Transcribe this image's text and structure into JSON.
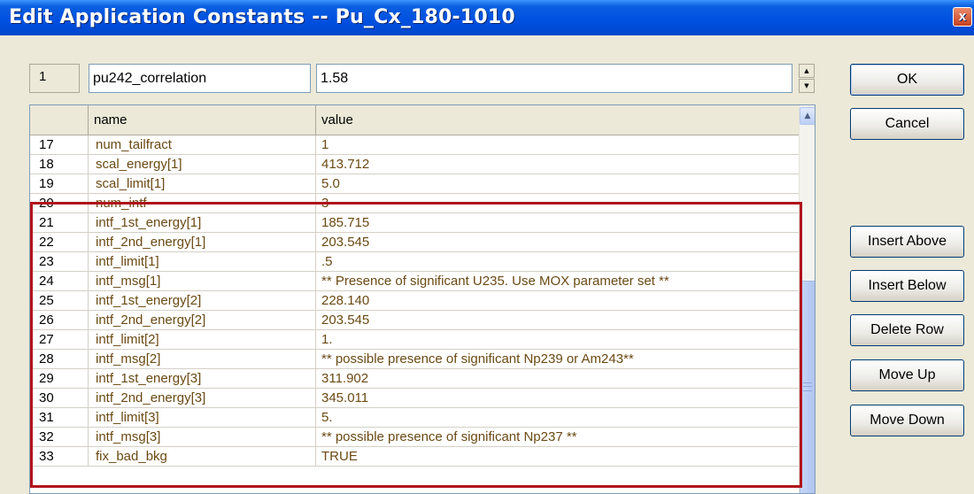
{
  "window": {
    "title": "Edit Application Constants  --  Pu_Cx_180-1010",
    "close_glyph": "x"
  },
  "editor": {
    "row_number": "1",
    "name_value": "pu242_correlation",
    "value_value": "1.58"
  },
  "buttons": {
    "ok": "OK",
    "cancel": "Cancel",
    "insert_above": "Insert Above",
    "insert_below": "Insert Below",
    "delete_row": "Delete Row",
    "move_up": "Move Up",
    "move_down": "Move Down"
  },
  "grid": {
    "headers": [
      "",
      "name",
      "value"
    ],
    "rows": [
      {
        "num": "17",
        "name": "num_tailfract",
        "value": "1"
      },
      {
        "num": "18",
        "name": "scal_energy[1]",
        "value": "413.712"
      },
      {
        "num": "19",
        "name": "scal_limit[1]",
        "value": "5.0"
      },
      {
        "num": "20",
        "name": "num_intf",
        "value": "3"
      },
      {
        "num": "21",
        "name": "intf_1st_energy[1]",
        "value": "185.715"
      },
      {
        "num": "22",
        "name": "intf_2nd_energy[1]",
        "value": "203.545"
      },
      {
        "num": "23",
        "name": "intf_limit[1]",
        "value": ".5"
      },
      {
        "num": "24",
        "name": "intf_msg[1]",
        "value": "** Presence of significant U235. Use MOX parameter set **"
      },
      {
        "num": "25",
        "name": "intf_1st_energy[2]",
        "value": "228.140"
      },
      {
        "num": "26",
        "name": "intf_2nd_energy[2]",
        "value": "203.545"
      },
      {
        "num": "27",
        "name": "intf_limit[2]",
        "value": "1."
      },
      {
        "num": "28",
        "name": "intf_msg[2]",
        "value": "** possible presence of significant Np239 or Am243**"
      },
      {
        "num": "29",
        "name": "intf_1st_energy[3]",
        "value": "311.902"
      },
      {
        "num": "30",
        "name": "intf_2nd_energy[3]",
        "value": "345.011"
      },
      {
        "num": "31",
        "name": "intf_limit[3]",
        "value": "5."
      },
      {
        "num": "32",
        "name": "intf_msg[3]",
        "value": "** possible presence of significant Np237 **"
      },
      {
        "num": "33",
        "name": "fix_bad_bkg",
        "value": "TRUE"
      }
    ]
  },
  "colors": {
    "highlight_border": "#B0141C",
    "cell_text": "#6B4A14",
    "titlebar": "#0050E0"
  }
}
